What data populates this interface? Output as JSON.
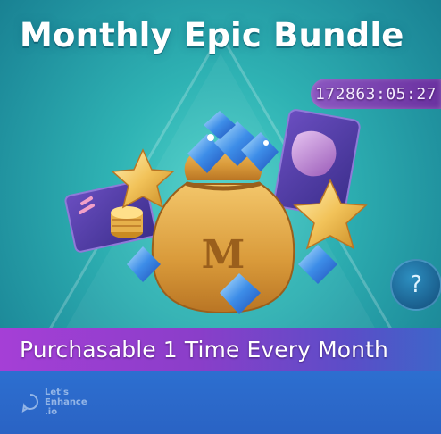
{
  "title": "Monthly Epic Bundle",
  "timer": "172863:05:27",
  "banner": "Purchasable 1 Time Every Month",
  "help_label": "?",
  "bag_letter": "M",
  "watermark": "Let's\nEnhance\n.io",
  "colors": {
    "background": "#2fb3b4",
    "banner": "#8a3ec9",
    "timer": "#9c48c4",
    "footer": "#2d6fd0"
  },
  "icons": [
    "money-bag-icon",
    "blue-diamond-icon",
    "gold-star-icon",
    "coin-stack-icon",
    "purple-card-icon",
    "help-icon"
  ]
}
